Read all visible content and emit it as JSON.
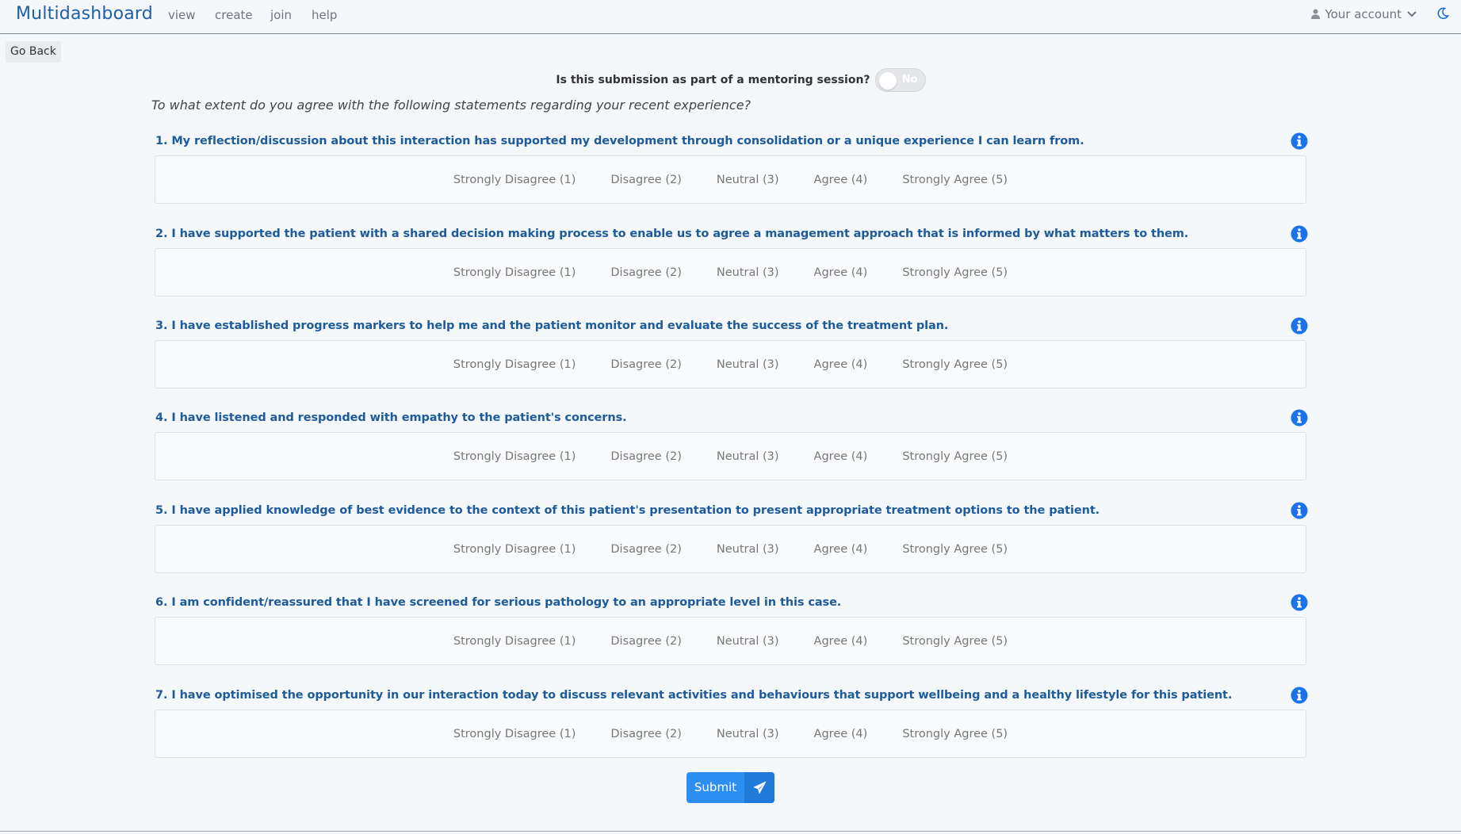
{
  "app": {
    "brand": "Multidashboard",
    "nav": [
      {
        "label": "view"
      },
      {
        "label": "create"
      },
      {
        "label": "join"
      },
      {
        "label": "help"
      }
    ],
    "account_label": "Your account"
  },
  "go_back_label": "Go Back",
  "mentoring": {
    "label": "Is this submission as part of a mentoring session?",
    "toggle_value": "No"
  },
  "intro": "To what extent do you agree with the following statements regarding your recent experience?",
  "options": [
    "Strongly Disagree (1)",
    "Disagree (2)",
    "Neutral (3)",
    "Agree (4)",
    "Strongly Agree (5)"
  ],
  "questions": [
    {
      "text": "1. My reflection/discussion about this interaction has supported my development through consolidation or a unique experience I can learn from."
    },
    {
      "text": "2. I have supported the patient with a shared decision making process to enable us to agree a management approach that is informed by what matters to them."
    },
    {
      "text": "3. I have established progress markers to help me and the patient monitor and evaluate the success of the treatment plan."
    },
    {
      "text": "4. I have listened and responded with empathy to the patient's concerns."
    },
    {
      "text": "5. I have applied knowledge of best evidence to the context of this patient's presentation to present appropriate treatment options to the patient."
    },
    {
      "text": "6. I am confident/reassured that I have screened for serious pathology to an appropriate level in this case."
    },
    {
      "text": "7. I have optimised the opportunity in our interaction today to discuss relevant activities and behaviours that support wellbeing and a healthy lifestyle for this patient."
    }
  ],
  "submit_label": "Submit",
  "icons": {
    "account": "user-icon",
    "account_caret": "chevron-down-icon",
    "theme": "moon-icon",
    "info": "info-icon",
    "submit": "paper-plane-icon"
  },
  "colors": {
    "brand": "#1f5fa8",
    "question_text": "#1d5b9c",
    "info_icon": "#1a73e8",
    "submit_button": "#2b8ef0"
  }
}
